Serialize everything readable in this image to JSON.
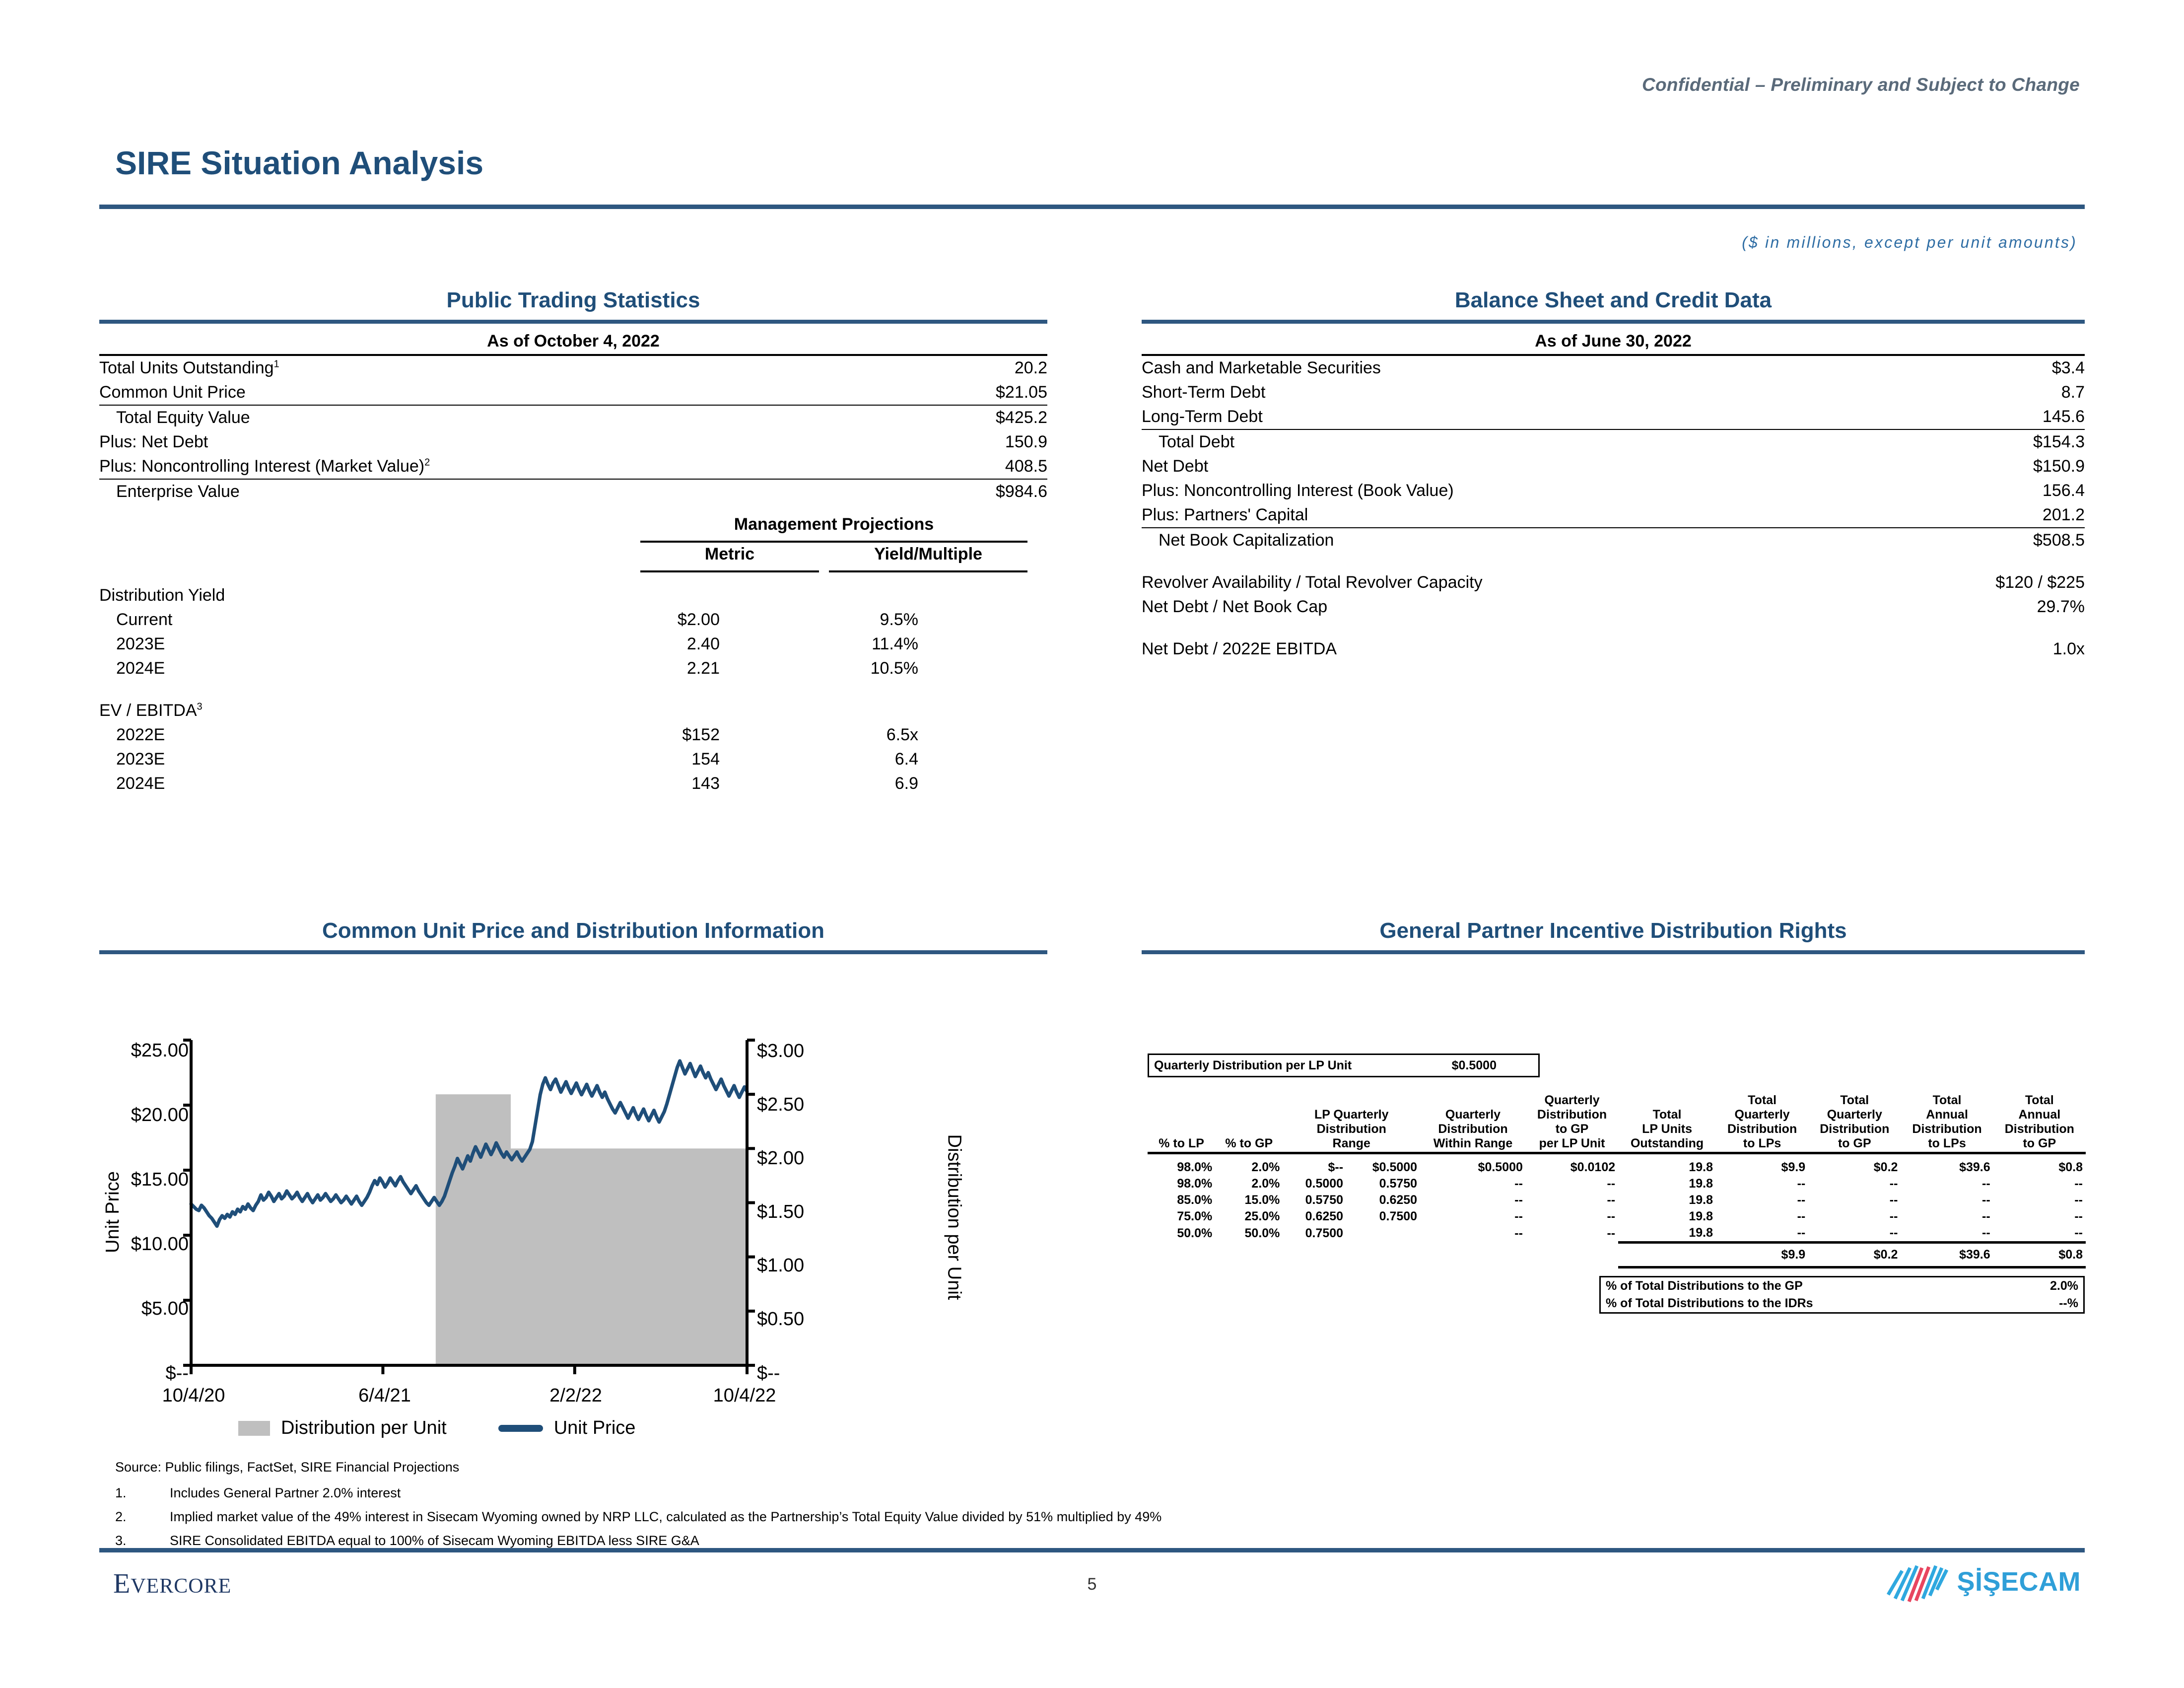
{
  "header": {
    "confidential": "Confidential – Preliminary and Subject to Change",
    "title": "SIRE Situation Analysis",
    "units_note": "($ in millions, except per unit amounts)"
  },
  "public_trading": {
    "panel_title": "Public Trading Statistics",
    "as_of": "As of October 4, 2022",
    "rows": [
      {
        "label": "Total Units Outstanding",
        "sup": "1",
        "value": "20.2"
      },
      {
        "label": "Common Unit Price",
        "sup": "",
        "value": "$21.05"
      },
      {
        "label": "Total Equity Value",
        "sup": "",
        "value": "$425.2"
      },
      {
        "label": "Plus: Net Debt",
        "sup": "",
        "value": "150.9"
      },
      {
        "label": "Plus: Noncontrolling Interest (Market Value)",
        "sup": "2",
        "value": "408.5"
      },
      {
        "label": "Enterprise Value",
        "sup": "",
        "value": "$984.6"
      }
    ],
    "projections_header": "Management Projections",
    "col_metric": "Metric",
    "col_yield": "Yield/Multiple",
    "distribution_yield_label": "Distribution Yield",
    "distribution_yield_rows": [
      {
        "label": "Current",
        "metric": "$2.00",
        "yield": "9.5%"
      },
      {
        "label": "2023E",
        "metric": "2.40",
        "yield": "11.4%"
      },
      {
        "label": "2024E",
        "metric": "2.21",
        "yield": "10.5%"
      }
    ],
    "ev_ebitda_label": "EV / EBITDA",
    "ev_ebitda_sup": "3",
    "ev_ebitda_rows": [
      {
        "label": "2022E",
        "metric": "$152",
        "yield": "6.5x"
      },
      {
        "label": "2023E",
        "metric": "154",
        "yield": "6.4"
      },
      {
        "label": "2024E",
        "metric": "143",
        "yield": "6.9"
      }
    ]
  },
  "balance_sheet": {
    "panel_title": "Balance Sheet and Credit Data",
    "as_of": "As of June 30, 2022",
    "rows": [
      {
        "label": "Cash and Marketable Securities",
        "value": "$3.4"
      },
      {
        "label": "Short-Term Debt",
        "value": "8.7"
      },
      {
        "label": "Long-Term Debt",
        "value": "145.6"
      },
      {
        "label": "Total Debt",
        "value": "$154.3"
      },
      {
        "label": "Net Debt",
        "value": "$150.9"
      },
      {
        "label": "Plus: Noncontrolling Interest (Book Value)",
        "value": "156.4"
      },
      {
        "label": "Plus: Partners' Capital",
        "value": "201.2"
      },
      {
        "label": "Net Book Capitalization",
        "value": "$508.5"
      }
    ],
    "credit_rows": [
      {
        "label": "Revolver Availability / Total Revolver Capacity",
        "value": "$120 / $225"
      },
      {
        "label": "Net Debt / Net Book Cap",
        "value": "29.7%"
      },
      {
        "label": "Net Debt / 2022E EBITDA",
        "value": "1.0x"
      }
    ]
  },
  "chart_panel": {
    "panel_title": "Common Unit Price and Distribution Information"
  },
  "idr_panel": {
    "panel_title": "General Partner Incentive Distribution Rights",
    "qd_label": "Quarterly Distribution per LP Unit",
    "qd_value": "$0.5000",
    "headers": [
      "% to LP",
      "% to GP",
      "LP Quarterly Distribution Range",
      "Quarterly Distribution Within Range",
      "Quarterly Distribution to GP per LP Unit",
      "Total LP Units Outstanding",
      "Total Quarterly Distribution to LPs",
      "Total Quarterly Distribution to GP",
      "Total Annual Distribution to LPs",
      "Total Annual Distribution to GP"
    ],
    "header_lines": {
      "pct_lp": [
        "% to LP"
      ],
      "pct_gp": [
        "% to GP"
      ],
      "range": [
        "LP Quarterly",
        "Distribution",
        "Range"
      ],
      "within": [
        "Quarterly",
        "Distribution",
        "Within Range"
      ],
      "to_gp_unit": [
        "Quarterly",
        "Distribution",
        "to GP",
        "per LP Unit"
      ],
      "lp_units": [
        "Total",
        "LP Units",
        "Outstanding"
      ],
      "tq_lps": [
        "Total",
        "Quarterly",
        "Distribution",
        "to LPs"
      ],
      "tq_gp": [
        "Total",
        "Quarterly",
        "Distribution",
        "to GP"
      ],
      "ta_lps": [
        "Total",
        "Annual",
        "Distribution",
        "to LPs"
      ],
      "ta_gp": [
        "Total",
        "Annual",
        "Distribution",
        "to GP"
      ]
    },
    "rows": [
      {
        "pct_lp": "98.0%",
        "pct_gp": "2.0%",
        "range_lo": "$--",
        "range_hi": "$0.5000",
        "within": "$0.5000",
        "to_gp_unit": "$0.0102",
        "lp_units": "19.8",
        "tq_lps": "$9.9",
        "tq_gp": "$0.2",
        "ta_lps": "$39.6",
        "ta_gp": "$0.8"
      },
      {
        "pct_lp": "98.0%",
        "pct_gp": "2.0%",
        "range_lo": "0.5000",
        "range_hi": "0.5750",
        "within": "--",
        "to_gp_unit": "--",
        "lp_units": "19.8",
        "tq_lps": "--",
        "tq_gp": "--",
        "ta_lps": "--",
        "ta_gp": "--"
      },
      {
        "pct_lp": "85.0%",
        "pct_gp": "15.0%",
        "range_lo": "0.5750",
        "range_hi": "0.6250",
        "within": "--",
        "to_gp_unit": "--",
        "lp_units": "19.8",
        "tq_lps": "--",
        "tq_gp": "--",
        "ta_lps": "--",
        "ta_gp": "--"
      },
      {
        "pct_lp": "75.0%",
        "pct_gp": "25.0%",
        "range_lo": "0.6250",
        "range_hi": "0.7500",
        "within": "--",
        "to_gp_unit": "--",
        "lp_units": "19.8",
        "tq_lps": "--",
        "tq_gp": "--",
        "ta_lps": "--",
        "ta_gp": "--"
      },
      {
        "pct_lp": "50.0%",
        "pct_gp": "50.0%",
        "range_lo": "0.7500",
        "range_hi": "",
        "within": "--",
        "to_gp_unit": "--",
        "lp_units": "19.8",
        "tq_lps": "--",
        "tq_gp": "--",
        "ta_lps": "--",
        "ta_gp": "--"
      }
    ],
    "totals": {
      "tq_lps": "$9.9",
      "tq_gp": "$0.2",
      "ta_lps": "$39.6",
      "ta_gp": "$0.8"
    },
    "pct_gp_label": "% of Total Distributions to the GP",
    "pct_gp_value": "2.0%",
    "pct_idr_label": "% of Total Distributions to the IDRs",
    "pct_idr_value": "--%"
  },
  "footnotes": {
    "source": "Source: Public filings, FactSet, SIRE Financial Projections",
    "items": [
      {
        "num": "1.",
        "text": "Includes General Partner 2.0% interest"
      },
      {
        "num": "2.",
        "text": "Implied market value of the 49% interest in Sisecam Wyoming owned by NRP LLC, calculated as the Partnership’s Total Equity Value divided by 51% multiplied by 49%"
      },
      {
        "num": "3.",
        "text": "SIRE Consolidated EBITDA equal to 100% of Sisecam Wyoming EBITDA less SIRE G&A"
      }
    ]
  },
  "footer": {
    "bank_name_cap": "E",
    "bank_name_rest": "VERCORE",
    "page_number": "5",
    "company_name": "ŞİŞECAM"
  },
  "chart_data": {
    "type": "line",
    "title": "Common Unit Price and Distribution Information",
    "ylabel": "Unit Price",
    "y2label": "Distribution per Unit",
    "xlabel": "",
    "ylim": [
      0,
      25
    ],
    "y2lim": [
      0,
      3
    ],
    "yticks": [
      "$--",
      "$5.00",
      "$10.00",
      "$15.00",
      "$20.00",
      "$25.00"
    ],
    "y2ticks": [
      "$--",
      "$0.50",
      "$1.00",
      "$1.50",
      "$2.00",
      "$2.50",
      "$3.00"
    ],
    "xticks": [
      "10/4/20",
      "6/4/21",
      "2/2/22",
      "10/4/22"
    ],
    "grid": false,
    "legend_position": "bottom",
    "series": [
      {
        "name": "Unit Price",
        "type": "line",
        "color": "#1f4e79",
        "axis": "left",
        "values": [
          12.4,
          12.2,
          12.0,
          11.9,
          12.3,
          12.1,
          11.8,
          11.5,
          11.3,
          11.0,
          10.7,
          11.2,
          11.5,
          11.3,
          11.6,
          11.4,
          11.8,
          11.6,
          12.0,
          11.8,
          12.2,
          12.0,
          12.4,
          12.1,
          11.9,
          12.3,
          12.6,
          13.1,
          12.7,
          12.9,
          13.3,
          13.0,
          12.6,
          12.9,
          13.2,
          12.8,
          13.0,
          13.4,
          13.1,
          12.8,
          13.0,
          13.3,
          12.9,
          12.6,
          12.9,
          13.2,
          12.8,
          12.5,
          12.8,
          13.1,
          12.7,
          12.9,
          13.2,
          12.9,
          12.6,
          12.8,
          13.1,
          12.8,
          12.5,
          12.7,
          13.0,
          12.7,
          12.4,
          12.7,
          13.0,
          12.6,
          12.3,
          12.6,
          12.9,
          13.3,
          13.8,
          14.2,
          13.9,
          14.4,
          14.1,
          13.7,
          14.0,
          14.4,
          14.1,
          13.8,
          14.2,
          14.5,
          14.1,
          13.8,
          13.5,
          13.2,
          13.5,
          13.8,
          13.4,
          13.1,
          12.8,
          12.5,
          12.3,
          12.6,
          12.9,
          12.6,
          12.3,
          12.6,
          13.0,
          13.6,
          14.2,
          14.8,
          15.3,
          15.9,
          15.5,
          15.1,
          15.6,
          16.1,
          15.7,
          16.3,
          16.8,
          16.4,
          16.0,
          16.5,
          17.0,
          16.6,
          16.2,
          16.6,
          17.1,
          16.7,
          16.3,
          16.0,
          16.4,
          16.1,
          15.8,
          16.1,
          16.4,
          16.0,
          15.7,
          16.0,
          16.3,
          16.6,
          17.2,
          18.4,
          19.6,
          20.8,
          21.6,
          22.1,
          21.6,
          21.2,
          21.7,
          22.0,
          21.5,
          21.0,
          21.4,
          21.8,
          21.3,
          20.9,
          21.3,
          21.7,
          21.2,
          20.8,
          21.2,
          21.6,
          21.1,
          20.7,
          21.1,
          21.5,
          21.0,
          20.6,
          21.0,
          20.5,
          20.1,
          19.7,
          19.4,
          19.8,
          20.2,
          19.8,
          19.4,
          19.0,
          19.4,
          19.8,
          19.3,
          18.9,
          19.3,
          19.7,
          19.2,
          18.8,
          19.2,
          19.6,
          19.1,
          18.7,
          19.1,
          19.5,
          20.1,
          20.8,
          21.5,
          22.2,
          22.9,
          23.4,
          22.9,
          22.4,
          22.8,
          23.2,
          22.7,
          22.2,
          22.6,
          23.0,
          22.5,
          22.1,
          22.5,
          22.0,
          21.6,
          21.2,
          21.6,
          22.0,
          21.5,
          21.1,
          20.7,
          21.1,
          21.5,
          21.0,
          20.6,
          21.0,
          21.4,
          21.05
        ]
      },
      {
        "name": "Distribution per Unit",
        "type": "bar",
        "color": "#bfbfbf",
        "axis": "right",
        "steps": [
          {
            "from_x_pct": 44.0,
            "to_x_pct": 57.5,
            "value": 2.5
          },
          {
            "from_x_pct": 57.5,
            "to_x_pct": 100.0,
            "value": 2.0
          }
        ]
      }
    ],
    "legend": [
      {
        "label": "Distribution per Unit",
        "marker": "bar",
        "color": "#bfbfbf"
      },
      {
        "label": "Unit Price",
        "marker": "line",
        "color": "#1f4e79"
      }
    ]
  }
}
